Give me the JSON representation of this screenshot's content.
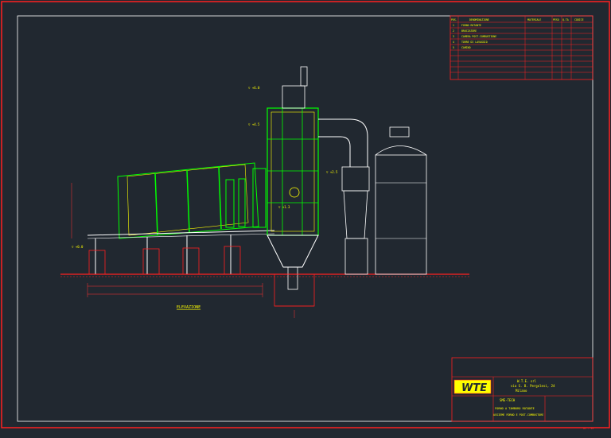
{
  "colors": {
    "background": "#212830",
    "frame": "#ff2020",
    "inner_frame": "#ffffff",
    "equipment": "#00ff00",
    "structure": "#ffffff",
    "dimension": "#ff3030",
    "annotation": "#ffff00",
    "ground": "#ff2020",
    "logo_fill": "#ffff00"
  },
  "elevation_tags": [
    "▽ +6.0",
    "▽ +4.5",
    "▽ +2.5",
    "▽ +1.3",
    "▽ +0.0"
  ],
  "drawing_label": "ELEVAZIONE",
  "parts_table": {
    "header": [
      "POS.",
      "DENOMINAZIONE",
      "MATERIALE",
      "PESO",
      "Q.TA",
      "CODICE"
    ],
    "rows": [
      [
        "1",
        "FORNO ROTANTE",
        "",
        "",
        "",
        ""
      ],
      [
        "2",
        "BRUCIATORE",
        "",
        "",
        "",
        ""
      ],
      [
        "3",
        "CAMERA POST-COMBUSTIONE",
        "",
        "",
        "",
        ""
      ],
      [
        "4",
        "TORRE DI LAVAGGIO",
        "",
        "",
        "",
        ""
      ],
      [
        "5",
        "CAMINO",
        "",
        "",
        "",
        ""
      ]
    ]
  },
  "title_block": {
    "logo": "WTE",
    "company": "W.T.E. srl",
    "address": "via S. B. Pergolesi, 24",
    "city": "Milano",
    "project": "SME-TECH",
    "line_1": "FORNO A TAMBURO ROTANTE",
    "line_2": "ASSIEME FORNO E POST-COMBUSTORE"
  },
  "footer_ref": "A1 - 01"
}
